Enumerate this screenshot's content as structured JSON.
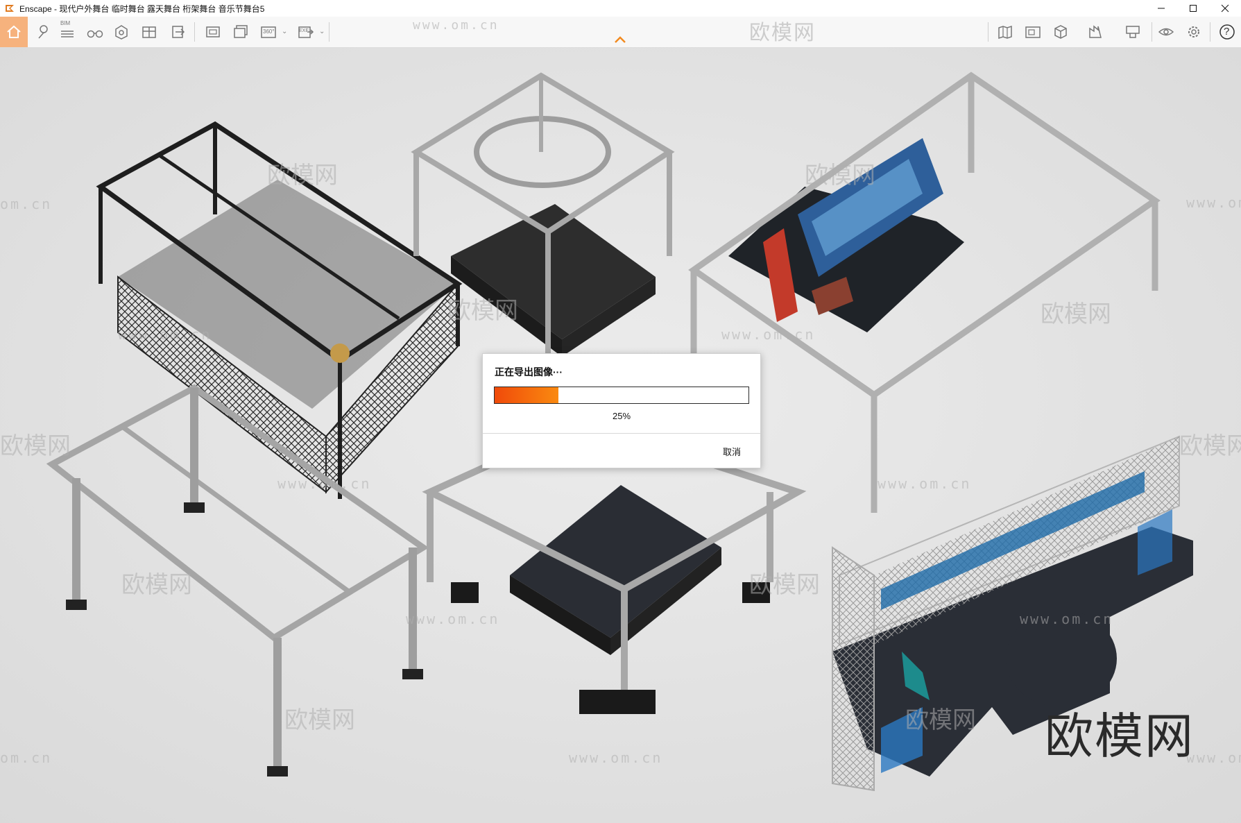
{
  "window": {
    "title": "Enscape - 现代户外舞台 临时舞台 露天舞台 桁架舞台 音乐节舞台5",
    "controls": [
      "minimize-icon",
      "maximize-icon",
      "close-icon"
    ]
  },
  "toolbar": {
    "left_icons": [
      "home-icon",
      "location-pin-icon",
      "bim-icon",
      "binoculars-icon",
      "asset-library-icon",
      "material-editor-icon",
      "export-icon",
      "screenshot-icon",
      "batch-render-icon",
      "panorama-360-icon",
      "exe-export-icon"
    ],
    "bim_label": "BIM",
    "pano_label": "360°",
    "exe_label": "EXE",
    "right_icons": [
      "map-icon",
      "video-editor-icon",
      "cube-icon",
      "section-icon",
      "chart-settings-icon",
      "visibility-icon",
      "settings-icon",
      "help-icon"
    ],
    "help_label": "?",
    "accent_color": "#f6b27d"
  },
  "viewport": {
    "watermark_url": "www.om.cn",
    "watermark_brand": "欧模网",
    "watermark_domain_fragment": "om.cn",
    "big_watermark": "欧模网"
  },
  "dialog": {
    "title": "正在导出图像···",
    "progress_fraction": 0.25,
    "progress_text": "25%",
    "cancel_label": "取消",
    "bar_color_start": "#f04a0a",
    "bar_color_end": "#fa8a10"
  }
}
